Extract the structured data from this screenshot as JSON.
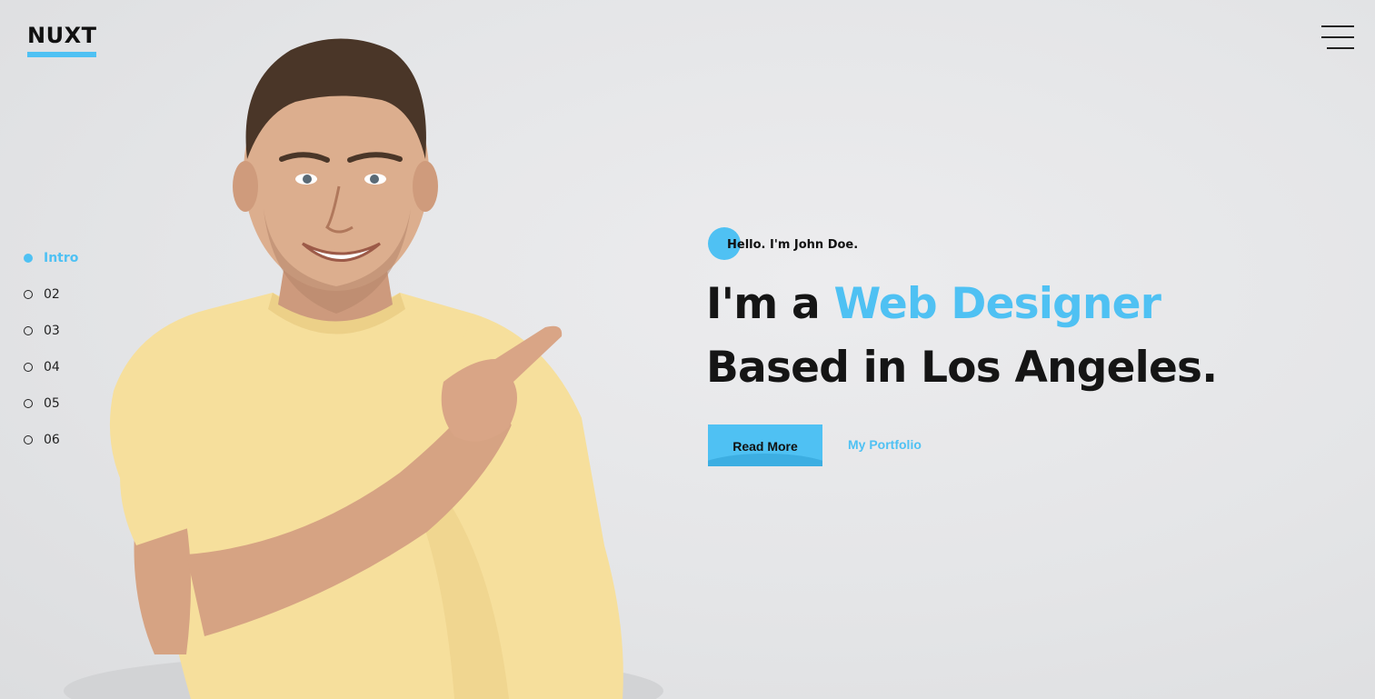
{
  "brand": {
    "logo_text": "NUXT",
    "accent_color": "#4fc1f3"
  },
  "header": {
    "menu_icon": "hamburger-menu-icon"
  },
  "side_nav": {
    "items": [
      {
        "label": "Intro",
        "active": true
      },
      {
        "label": "02",
        "active": false
      },
      {
        "label": "03",
        "active": false
      },
      {
        "label": "04",
        "active": false
      },
      {
        "label": "05",
        "active": false
      },
      {
        "label": "06",
        "active": false
      }
    ]
  },
  "hero": {
    "greeting": "Hello. I'm John Doe.",
    "headline_prefix": "I'm a ",
    "headline_accent": "Web Designer",
    "headline_line2": "Based in Los Angeles.",
    "primary_button": "Read More",
    "secondary_link": "My Portfolio"
  },
  "photo": {
    "subject": "smiling man in yellow t-shirt pointing"
  }
}
